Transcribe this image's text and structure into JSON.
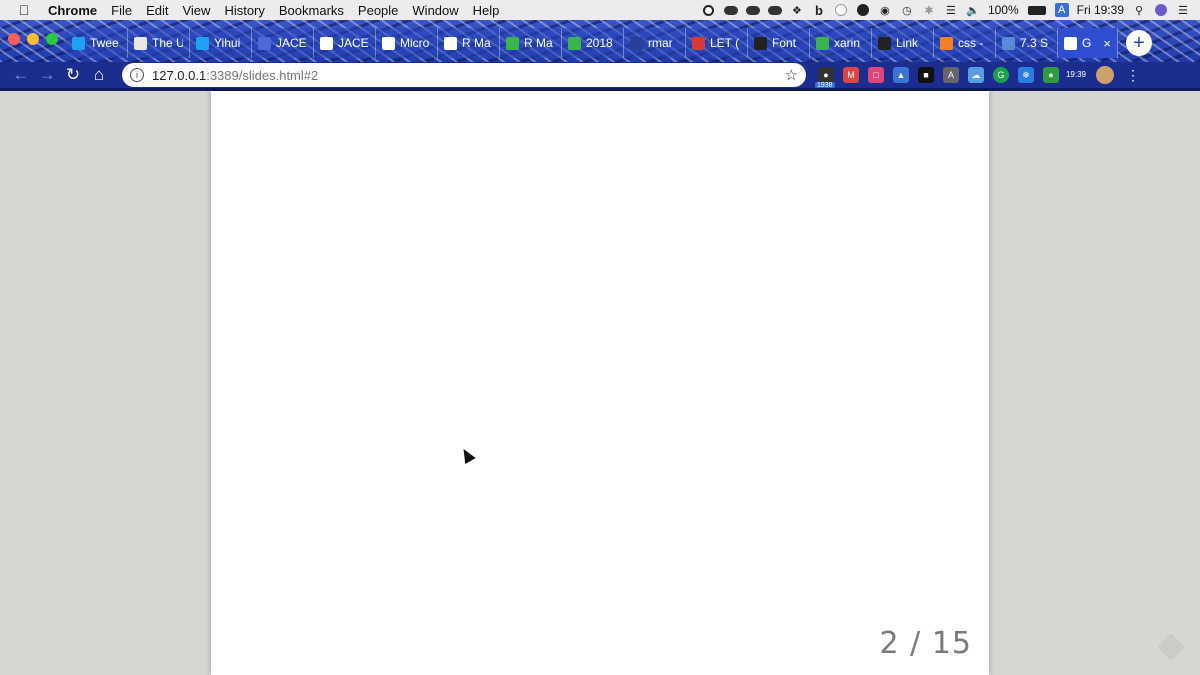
{
  "menubar": {
    "app_name": "Chrome",
    "menus": [
      "File",
      "Edit",
      "View",
      "History",
      "Bookmarks",
      "People",
      "Window",
      "Help"
    ],
    "battery": "100%",
    "clock": "Fri 19:39"
  },
  "tabs": [
    {
      "label": "Twee",
      "icon": "twitter-icon",
      "color": "#1da1f2"
    },
    {
      "label": "The U",
      "icon": "site-icon",
      "color": "#e8e8e8"
    },
    {
      "label": "Yihui",
      "icon": "twitter-icon",
      "color": "#1da1f2"
    },
    {
      "label": "JACE",
      "icon": "site-icon",
      "color": "#4a6bd8"
    },
    {
      "label": "JACE",
      "icon": "document-icon",
      "color": "#ffffff"
    },
    {
      "label": "Micro",
      "icon": "document-icon",
      "color": "#ffffff"
    },
    {
      "label": "R Ma",
      "icon": "document-icon",
      "color": "#ffffff"
    },
    {
      "label": "R Ma",
      "icon": "rstudio-icon",
      "color": "#3ab54a"
    },
    {
      "label": "2018",
      "icon": "site-icon",
      "color": "#3ab54a"
    },
    {
      "label": "rmar",
      "icon": "site-icon",
      "color": "#2b3f9a"
    },
    {
      "label": "LET (",
      "icon": "site-icon",
      "color": "#d63b3b"
    },
    {
      "label": "Font",
      "icon": "github-icon",
      "color": "#222222"
    },
    {
      "label": "xarin",
      "icon": "rstudio-icon",
      "color": "#3ab54a"
    },
    {
      "label": "Link",
      "icon": "github-icon",
      "color": "#222222"
    },
    {
      "label": "css -",
      "icon": "stackoverflow-icon",
      "color": "#f48024"
    },
    {
      "label": "7.3 S",
      "icon": "r-icon",
      "color": "#5a8bd8"
    },
    {
      "label": "G",
      "icon": "document-icon",
      "color": "#ffffff",
      "active": true
    }
  ],
  "toolbar": {
    "url_host": "127.0.0.1",
    "url_path": ":3389/slides.html#2",
    "extension_badge": "1938",
    "clock_ext": "19:39"
  },
  "slide": {
    "number_text": "2 / 15"
  }
}
